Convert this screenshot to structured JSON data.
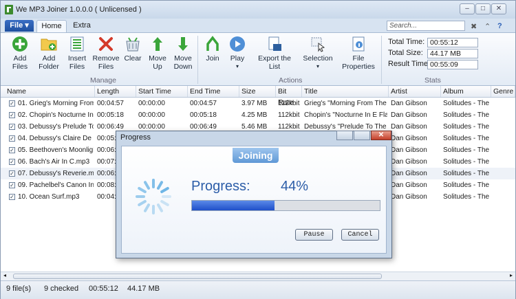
{
  "window": {
    "title": "We MP3 Joiner 1.0.0.0  ( Unlicensed )"
  },
  "ribbon": {
    "file_tab": "File ▾",
    "tabs": [
      {
        "label": "Home"
      },
      {
        "label": "Extra"
      }
    ],
    "search_placeholder": "Search...",
    "buttons": {
      "add_files": "Add\nFiles",
      "add_folder": "Add\nFolder",
      "insert_files": "Insert\nFiles",
      "remove_files": "Remove\nFiles",
      "clear": "Clear",
      "move_up": "Move\nUp",
      "move_down": "Move\nDown",
      "join": "Join",
      "play": "Play",
      "export_list": "Export the\nList",
      "selection": "Selection",
      "file_properties": "File\nProperties"
    },
    "groups": {
      "manage": "Manage",
      "actions": "Actions",
      "stats": "Stats"
    },
    "stats": {
      "total_time_label": "Total Time:",
      "total_time": "00:55:12",
      "total_size_label": "Total Size:",
      "total_size": "44.17 MB",
      "result_time_label": "Result Time:",
      "result_time": "00:55:09"
    }
  },
  "table": {
    "columns": [
      "Name",
      "Length",
      "Start Time",
      "End Time",
      "Size",
      "Bit Rate",
      "Title",
      "Artist",
      "Album",
      "Genre"
    ],
    "rows": [
      {
        "name": "01. Grieg's  Morning From...",
        "length": "00:04:57",
        "start": "00:00:00",
        "end": "00:04:57",
        "size": "3.97 MB",
        "bitrate": "112kbit",
        "title": "Grieg's \"Morning From The Pie...",
        "artist": "Dan Gibson",
        "album": "Solitudes - The..."
      },
      {
        "name": "02. Chopin's  Nocturne In E...",
        "length": "00:05:18",
        "start": "00:00:00",
        "end": "00:05:18",
        "size": "4.25 MB",
        "bitrate": "112kbit",
        "title": "Chopin's \"Nocturne In E Flat,...",
        "artist": "Dan Gibson",
        "album": "Solitudes - The..."
      },
      {
        "name": "03. Debussy's  Prelude To...",
        "length": "00:06:49",
        "start": "00:00:00",
        "end": "00:06:49",
        "size": "5.46 MB",
        "bitrate": "112kbit",
        "title": "Debussy's \"Prelude To The Aft...",
        "artist": "Dan Gibson",
        "album": "Solitudes - The..."
      },
      {
        "name": "04. Debussy's  Claire De Lu...",
        "length": "00:05:...",
        "start": "",
        "end": "",
        "size": "",
        "bitrate": "",
        "title": "",
        "artist": "Dan Gibson",
        "album": "Solitudes - The..."
      },
      {
        "name": "05. Beethoven's  Moonlight...",
        "length": "00:06:...",
        "start": "",
        "end": "",
        "size": "",
        "bitrate": "",
        "title": "",
        "artist": "Dan Gibson",
        "album": "Solitudes - The..."
      },
      {
        "name": "06. Bach's  Air In C.mp3",
        "length": "00:07:...",
        "start": "",
        "end": "",
        "size": "",
        "bitrate": "",
        "title": "",
        "artist": "Dan Gibson",
        "album": "Solitudes - The..."
      },
      {
        "name": "07. Debussy's  Reverie.mp3",
        "length": "00:06:...",
        "start": "",
        "end": "",
        "size": "",
        "bitrate": "",
        "title": "",
        "artist": "Dan Gibson",
        "album": "Solitudes - The..."
      },
      {
        "name": "09. Pachelbel's  Canon In D...",
        "length": "00:08:...",
        "start": "",
        "end": "",
        "size": "",
        "bitrate": "",
        "title": "",
        "artist": "Dan Gibson",
        "album": "Solitudes - The..."
      },
      {
        "name": "10. Ocean Surf.mp3",
        "length": "00:04:2...",
        "start": "",
        "end": "",
        "size": "",
        "bitrate": "",
        "title": "",
        "artist": "Dan Gibson",
        "album": "Solitudes - The..."
      }
    ]
  },
  "status": {
    "files": "9 file(s)",
    "checked": "9 checked",
    "time": "00:55:12",
    "size": "44.17 MB"
  },
  "dialog": {
    "title": "Progress",
    "header": "Joining",
    "progress_label": "Progress:",
    "progress_text": "44%",
    "progress_fraction": 0.44,
    "pause": "Pause",
    "cancel": "Cancel"
  },
  "colors": {
    "accent": "#2c5da8",
    "progress_fill": "#2a57cf",
    "file_tab": "#2a5eb5"
  }
}
